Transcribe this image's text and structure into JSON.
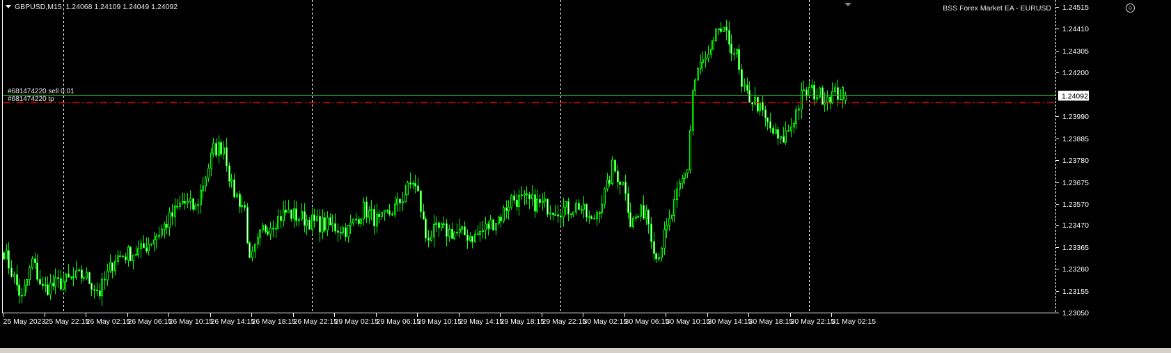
{
  "header": {
    "symbol": "GBPUSD,M15",
    "ohlc": "1.24068 1.24109 1.24049 1.24092"
  },
  "expert": {
    "label": "BSS Forex Market EA - EURUSD",
    "icon": "smiley-icon"
  },
  "orders": {
    "sell_label": "#681474220 sell 0.01",
    "tp_label": "#681474220 tp"
  },
  "colors": {
    "background": "#000000",
    "candle": "#00ff00",
    "bid_line": "#1ec81e",
    "tp_line": "#ff0000",
    "grid": "#ffffff",
    "text": "#ffffff"
  },
  "chart_data": {
    "type": "candlestick",
    "title": "GBPUSD,M15",
    "timeframe": "M15",
    "last_bar": {
      "open": 1.24068,
      "high": 1.24109,
      "low": 1.24049,
      "close": 1.24092
    },
    "bid": 1.24092,
    "tp_level": 1.24058,
    "ylim": [
      1.2305,
      1.24515
    ],
    "y_ticks": [
      "1.24515",
      "1.24410",
      "1.24305",
      "1.24200",
      "1.23990",
      "1.23885",
      "1.23780",
      "1.23675",
      "1.23570",
      "1.23470",
      "1.23365",
      "1.23260",
      "1.23155",
      "1.23050"
    ],
    "bid_label": "1.24092",
    "x_ticks": [
      "25 May 2023",
      "25 May 22:15",
      "26 May 02:15",
      "26 May 06:15",
      "26 May 10:15",
      "26 May 14:15",
      "26 May 18:15",
      "26 May 22:15",
      "29 May 02:15",
      "29 May 06:15",
      "29 May 10:15",
      "29 May 14:15",
      "29 May 18:15",
      "29 May 22:15",
      "30 May 02:15",
      "30 May 06:15",
      "30 May 10:15",
      "30 May 14:15",
      "30 May 18:15",
      "30 May 22:15",
      "31 May 02:15"
    ],
    "bars_per_tick": 16,
    "day_separators_bar": [
      23,
      119,
      215,
      311
    ],
    "close_keypoints": [
      [
        0,
        1.23347
      ],
      [
        7,
        1.23113
      ],
      [
        11,
        1.23297
      ],
      [
        15,
        1.23163
      ],
      [
        23,
        1.23197
      ],
      [
        31,
        1.2323
      ],
      [
        37,
        1.23147
      ],
      [
        43,
        1.23314
      ],
      [
        53,
        1.23347
      ],
      [
        61,
        1.23447
      ],
      [
        69,
        1.23581
      ],
      [
        74,
        1.23547
      ],
      [
        81,
        1.23831
      ],
      [
        85,
        1.23848
      ],
      [
        88,
        1.23647
      ],
      [
        93,
        1.23547
      ],
      [
        95,
        1.2328
      ],
      [
        100,
        1.23447
      ],
      [
        109,
        1.23531
      ],
      [
        120,
        1.2348
      ],
      [
        133,
        1.23447
      ],
      [
        139,
        1.23547
      ],
      [
        145,
        1.2348
      ],
      [
        152,
        1.23564
      ],
      [
        158,
        1.23681
      ],
      [
        160,
        1.23614
      ],
      [
        163,
        1.23414
      ],
      [
        168,
        1.23447
      ],
      [
        182,
        1.23414
      ],
      [
        192,
        1.23514
      ],
      [
        196,
        1.23597
      ],
      [
        203,
        1.23581
      ],
      [
        214,
        1.23547
      ],
      [
        218,
        1.23547
      ],
      [
        222,
        1.23564
      ],
      [
        227,
        1.2348
      ],
      [
        233,
        1.23647
      ],
      [
        235,
        1.23747
      ],
      [
        240,
        1.23647
      ],
      [
        242,
        1.2348
      ],
      [
        248,
        1.23547
      ],
      [
        252,
        1.23314
      ],
      [
        257,
        1.2348
      ],
      [
        261,
        1.23647
      ],
      [
        264,
        1.23747
      ],
      [
        266,
        1.24115
      ],
      [
        268,
        1.24215
      ],
      [
        270,
        1.24248
      ],
      [
        273,
        1.24281
      ],
      [
        276,
        1.24415
      ],
      [
        280,
        1.24348
      ],
      [
        283,
        1.24281
      ],
      [
        285,
        1.24115
      ],
      [
        291,
        1.24048
      ],
      [
        295,
        1.23948
      ],
      [
        300,
        1.23864
      ],
      [
        304,
        1.23948
      ],
      [
        308,
        1.24081
      ],
      [
        311,
        1.24115
      ],
      [
        316,
        1.24088
      ],
      [
        322,
        1.24098
      ],
      [
        325,
        1.24092
      ]
    ]
  }
}
